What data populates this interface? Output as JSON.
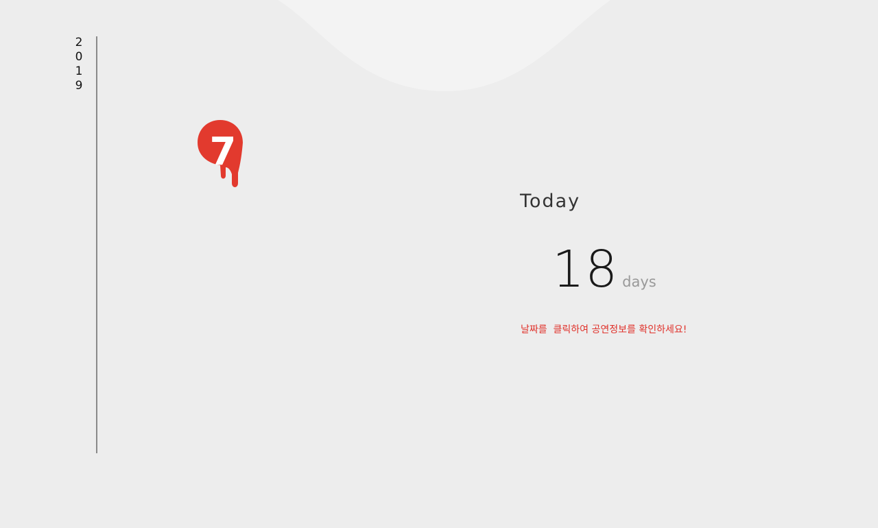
{
  "year_digits": [
    "2",
    "0",
    "1",
    "9"
  ],
  "month": {
    "number": "7",
    "icon": "dripping-paint-drop-icon",
    "accent_color": "#e23a2e"
  },
  "today": {
    "label": "Today",
    "days_count": "18",
    "days_unit": "days"
  },
  "hint": "날짜를  클릭하여 공연정보를 확인하세요!",
  "colors": {
    "background": "#ededed",
    "wave": "#f3f3f3",
    "timeline": "#8a8a8a",
    "hint": "#e0312a"
  }
}
